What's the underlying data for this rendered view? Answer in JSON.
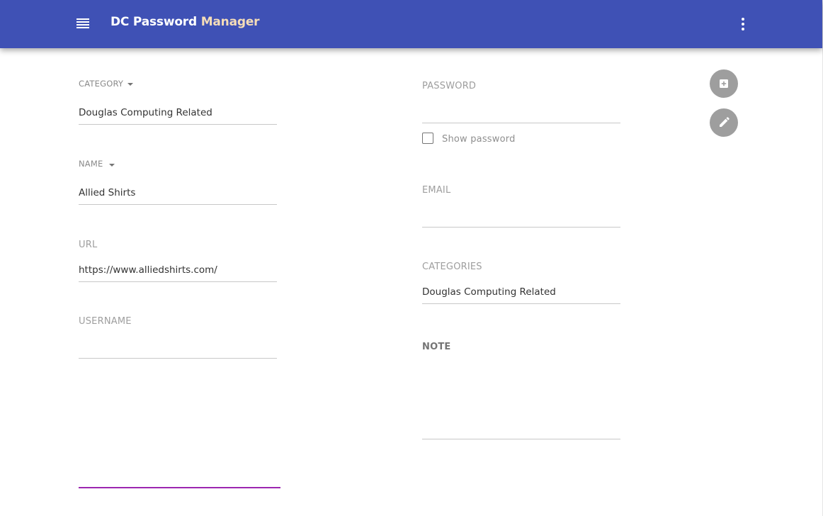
{
  "app": {
    "title_main": "DC Password",
    "title_accent": "Manager",
    "brand_color": "#3f51b5",
    "accent_color": "#f5ddb8"
  },
  "toolbar": {
    "menu_icon": "menu-icon",
    "more_icon": "more-vert-icon"
  },
  "left_form": {
    "category": {
      "label": "CATEGORY",
      "value": "Douglas Computing Related"
    },
    "name": {
      "label": "NAME",
      "value": "Allied Shirts"
    },
    "url": {
      "label": "URL",
      "value": "https://www.alliedshirts.com/"
    },
    "username": {
      "label": "USERNAME",
      "value": ""
    }
  },
  "right_form": {
    "password": {
      "label": "PASSWORD",
      "value": ""
    },
    "show_password": {
      "label": "Show password",
      "checked": false
    },
    "email": {
      "label": "EMAIL",
      "value": ""
    },
    "categories": {
      "label": "CATEGORIES",
      "value": "Douglas Computing Related"
    },
    "note": {
      "label": "NOTE",
      "value": ""
    }
  },
  "actions": {
    "add_icon": "add-box-icon",
    "edit_icon": "pencil-icon",
    "fab_color": "#9e9e9e"
  },
  "focus_color": "#9c27b0"
}
